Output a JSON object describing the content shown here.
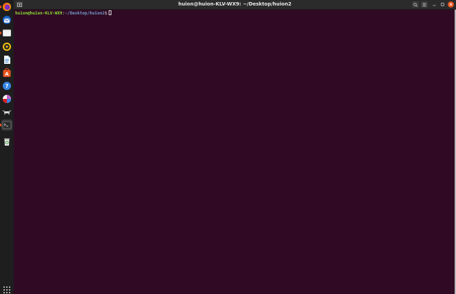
{
  "window": {
    "title": "huion@huion-KLV-WX9: ~/Desktop/huion2"
  },
  "terminal": {
    "prompt_user_host": "huion@huion-KLV-WX9",
    "prompt_separator": ":",
    "prompt_path": "~/Desktop/huion2",
    "prompt_symbol": "$"
  },
  "dock": {
    "items": [
      {
        "name": "firefox-icon",
        "color": "#ff7139"
      },
      {
        "name": "thunderbird-icon",
        "color": "#2f7fd3"
      },
      {
        "name": "files-icon",
        "color": "#cfcfcf"
      },
      {
        "name": "rhythmbox-icon",
        "color": "#f5c211"
      },
      {
        "name": "libreoffice-writer-icon",
        "color": "#2a7fcf"
      },
      {
        "name": "software-center-icon",
        "color": "#e95420"
      },
      {
        "name": "help-icon",
        "color": "#3584e4"
      },
      {
        "name": "app-icon",
        "color": "#c061cb"
      },
      {
        "name": "drone-app-icon",
        "color": "#dddddd"
      },
      {
        "name": "terminal-icon",
        "color": "#2c2c2c"
      },
      {
        "name": "trash-icon",
        "color": "#3a9a3a"
      },
      {
        "name": "show-apps-icon",
        "color": "#e0e0e0"
      }
    ]
  },
  "colors": {
    "terminal_bg": "#300a24",
    "prompt_user": "#8ae234",
    "prompt_path": "#729fcf",
    "accent": "#e95420"
  }
}
